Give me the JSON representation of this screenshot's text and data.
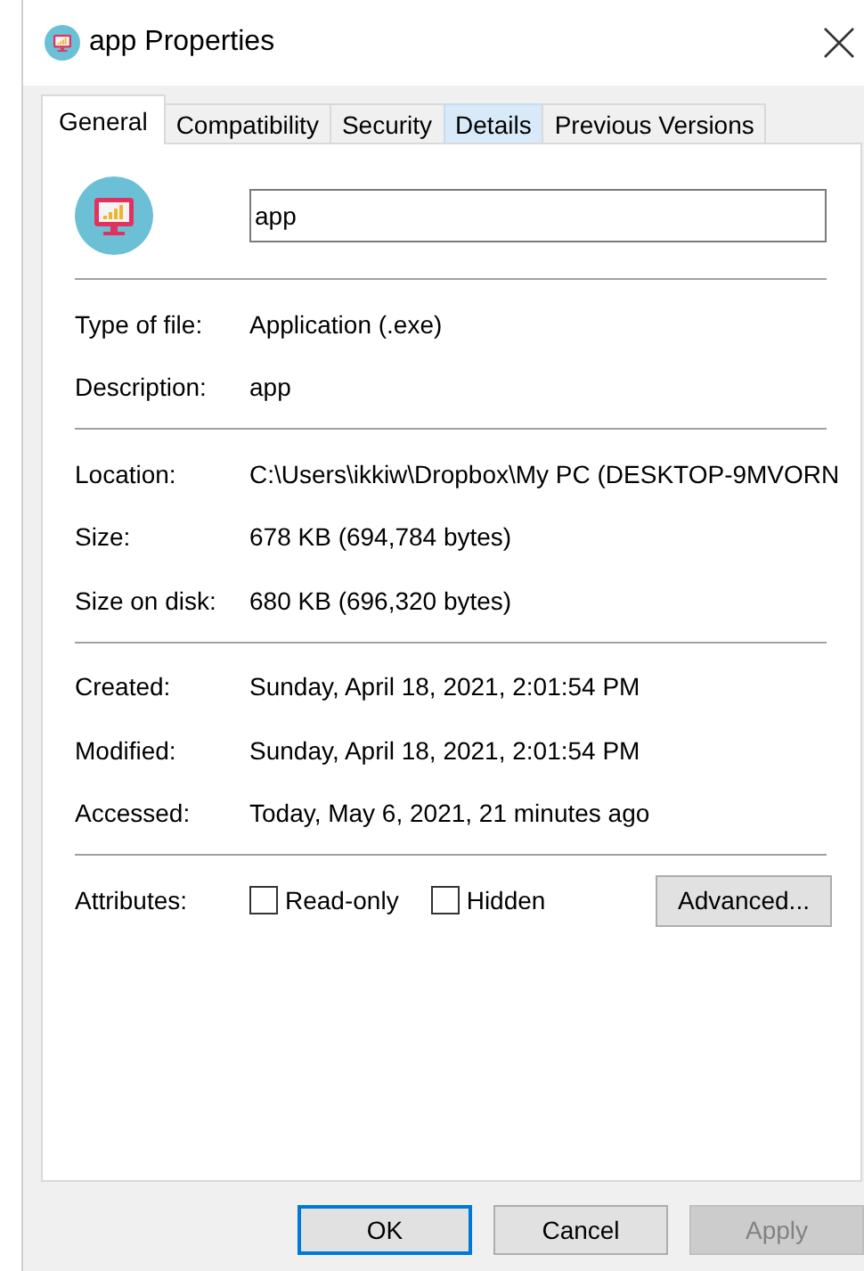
{
  "window": {
    "title": "app Properties"
  },
  "tabs": [
    {
      "label": "General",
      "selected": true,
      "hovered": false
    },
    {
      "label": "Compatibility",
      "selected": false,
      "hovered": false
    },
    {
      "label": "Security",
      "selected": false,
      "hovered": false
    },
    {
      "label": "Details",
      "selected": false,
      "hovered": true
    },
    {
      "label": "Previous Versions",
      "selected": false,
      "hovered": false
    }
  ],
  "file_name": {
    "value": "app"
  },
  "sections": [
    [
      {
        "label": "Type of file:",
        "value": "Application (.exe)"
      },
      {
        "label": "Description:",
        "value": "app"
      }
    ],
    [
      {
        "label": "Location:",
        "value": "C:\\Users\\ikkiw\\Dropbox\\My PC (DESKTOP-9MVORN"
      },
      {
        "label": "Size:",
        "value": "678 KB (694,784 bytes)"
      },
      {
        "label": "Size on disk:",
        "value": "680 KB (696,320 bytes)"
      }
    ],
    [
      {
        "label": "Created:",
        "value": "Sunday, April 18, 2021, 2:01:54 PM"
      },
      {
        "label": "Modified:",
        "value": "Sunday, April 18, 2021, 2:01:54 PM"
      },
      {
        "label": "Accessed:",
        "value": "Today, May 6, 2021, 21 minutes ago"
      }
    ]
  ],
  "attributes": {
    "label": "Attributes:",
    "checkboxes": [
      {
        "label": "Read-only",
        "checked": false
      },
      {
        "label": "Hidden",
        "checked": false
      }
    ],
    "advanced_button": "Advanced..."
  },
  "buttons": [
    {
      "label": "OK",
      "kind": "default",
      "disabled": false
    },
    {
      "label": "Cancel",
      "kind": "normal",
      "disabled": false
    },
    {
      "label": "Apply",
      "kind": "normal",
      "disabled": true
    }
  ]
}
